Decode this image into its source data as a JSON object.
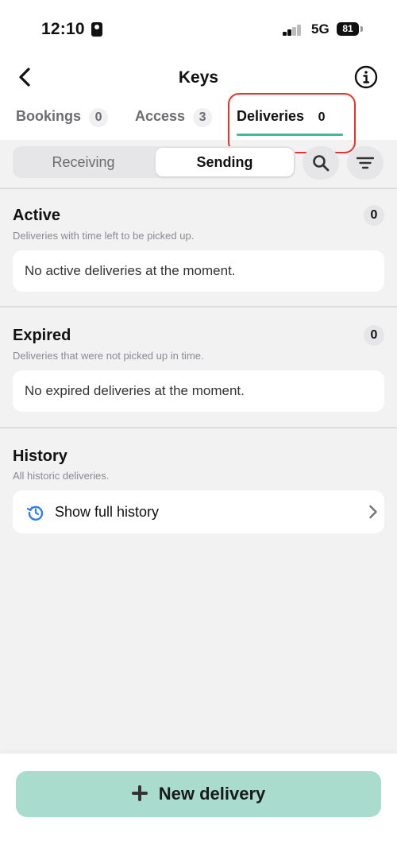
{
  "status_bar": {
    "time": "12:10",
    "network": "5G",
    "battery": "81"
  },
  "header": {
    "title": "Keys"
  },
  "tabs": [
    {
      "label": "Bookings",
      "count": "0"
    },
    {
      "label": "Access",
      "count": "3"
    },
    {
      "label": "Deliveries",
      "count": "0"
    }
  ],
  "active_tab": "Deliveries",
  "segmented": {
    "receiving": "Receiving",
    "sending": "Sending",
    "selected": "Sending"
  },
  "sections": {
    "active": {
      "title": "Active",
      "subtitle": "Deliveries with time left to be picked up.",
      "count": "0",
      "empty_text": "No active deliveries at the moment."
    },
    "expired": {
      "title": "Expired",
      "subtitle": "Deliveries that were not picked up in time.",
      "count": "0",
      "empty_text": "No expired deliveries at the moment."
    },
    "history": {
      "title": "History",
      "subtitle": "All historic deliveries.",
      "link_label": "Show full history"
    }
  },
  "footer": {
    "new_delivery_label": "New delivery"
  },
  "colors": {
    "accent": "#43b99a",
    "button": "#a9dccc",
    "highlight": "#e8332a",
    "history_icon": "#2f7cf6"
  }
}
